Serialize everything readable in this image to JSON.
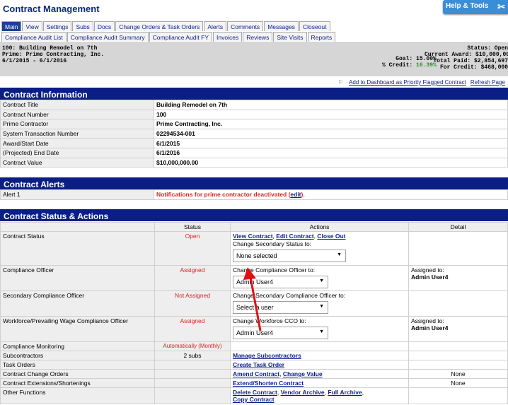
{
  "header": {
    "title": "Contract Management",
    "help_label": "Help & Tools"
  },
  "tabs_row1": [
    "Main",
    "View",
    "Settings",
    "Subs",
    "Docs",
    "Change Orders & Task Orders",
    "Alerts",
    "Comments",
    "Messages",
    "Closeout"
  ],
  "tabs_row2": [
    "Compliance Audit List",
    "Compliance Audit Summary",
    "Compliance Audit FY",
    "Invoices",
    "Reviews",
    "Site Visits",
    "Reports"
  ],
  "summary": {
    "line1": "100: Building Remodel on 7th",
    "line2": "Prime: Prime Contracting, Inc.",
    "line3": "6/1/2015 - 6/1/2016",
    "goal_label": "Goal:",
    "goal_value": "15.00%",
    "credit_label": "% Credit:",
    "credit_value": "16.39%",
    "status_label": "Status:",
    "status_value": "Open",
    "award_label": "Current Award:",
    "award_value": "$10,000,000",
    "paid_label": "Total Paid:",
    "paid_value": "$2,854,697",
    "forcredit_label": "For Credit:",
    "forcredit_value": "$468,000"
  },
  "links": {
    "priority": "Add to Dashboard as Priority Flagged Contract",
    "refresh": "Refresh Page"
  },
  "info": {
    "title": "Contract Information",
    "rows": [
      {
        "label": "Contract Title",
        "value": "Building Remodel on 7th"
      },
      {
        "label": "Contract Number",
        "value": "100"
      },
      {
        "label": "Prime Contractor",
        "value": "Prime Contracting, Inc."
      },
      {
        "label": "System Transaction Number",
        "value": "02294534-001"
      },
      {
        "label": "Award/Start Date",
        "value": "6/1/2015"
      },
      {
        "label": "(Projected) End Date",
        "value": "6/1/2016"
      },
      {
        "label": "Contract Value",
        "value": "$10,000,000.00"
      }
    ]
  },
  "alerts": {
    "title": "Contract Alerts",
    "label": "Alert 1",
    "text": "Notifications for prime contractor deactivated (",
    "edit": "edit",
    "close": ")."
  },
  "status": {
    "title": "Contract Status & Actions",
    "col_status": "Status",
    "col_actions": "Actions",
    "col_detail": "Detail",
    "contract_status": {
      "label": "Contract Status",
      "status": "Open",
      "view": "View Contract",
      "edit": "Edit Contract",
      "close": "Close Out",
      "change_label": "Change Secondary Status to:",
      "dropdown": "None selected"
    },
    "compliance_officer": {
      "label": "Compliance Officer",
      "status": "Assigned",
      "change_label": "Change Compliance Officer to:",
      "dropdown": "Admin User4",
      "detail_label": "Assigned to:",
      "detail_value": "Admin User4"
    },
    "secondary_officer": {
      "label": "Secondary Compliance Officer",
      "status": "Not Assigned",
      "change_label": "Change Secondary Compliance Officer to:",
      "dropdown": "Select a user"
    },
    "workforce_officer": {
      "label": "Workforce/Prevailing Wage Compliance Officer",
      "status": "Assigned",
      "change_label": "Change Workforce CCO to:",
      "dropdown": "Admin User4",
      "detail_label": "Assigned to:",
      "detail_value": "Admin User4"
    },
    "monitoring": {
      "label": "Compliance Monitoring",
      "status": "Automatically (Monthly)"
    },
    "subcontractors": {
      "label": "Subcontractors",
      "status": "2 subs",
      "action": "Manage Subcontractors"
    },
    "task_orders": {
      "label": "Task Orders",
      "action": "Create Task Order"
    },
    "change_orders": {
      "label": "Contract Change Orders",
      "amend": "Amend Contract",
      "change": "Change Value",
      "detail": "None"
    },
    "extensions": {
      "label": "Contract Extensions/Shortenings",
      "action": "Extend/Shorten Contract",
      "detail": "None"
    },
    "other": {
      "label": "Other Functions",
      "delete": "Delete Contract",
      "vendor": "Vendor Archive",
      "full": "Full Archive",
      "copy": "Copy Contract"
    }
  }
}
